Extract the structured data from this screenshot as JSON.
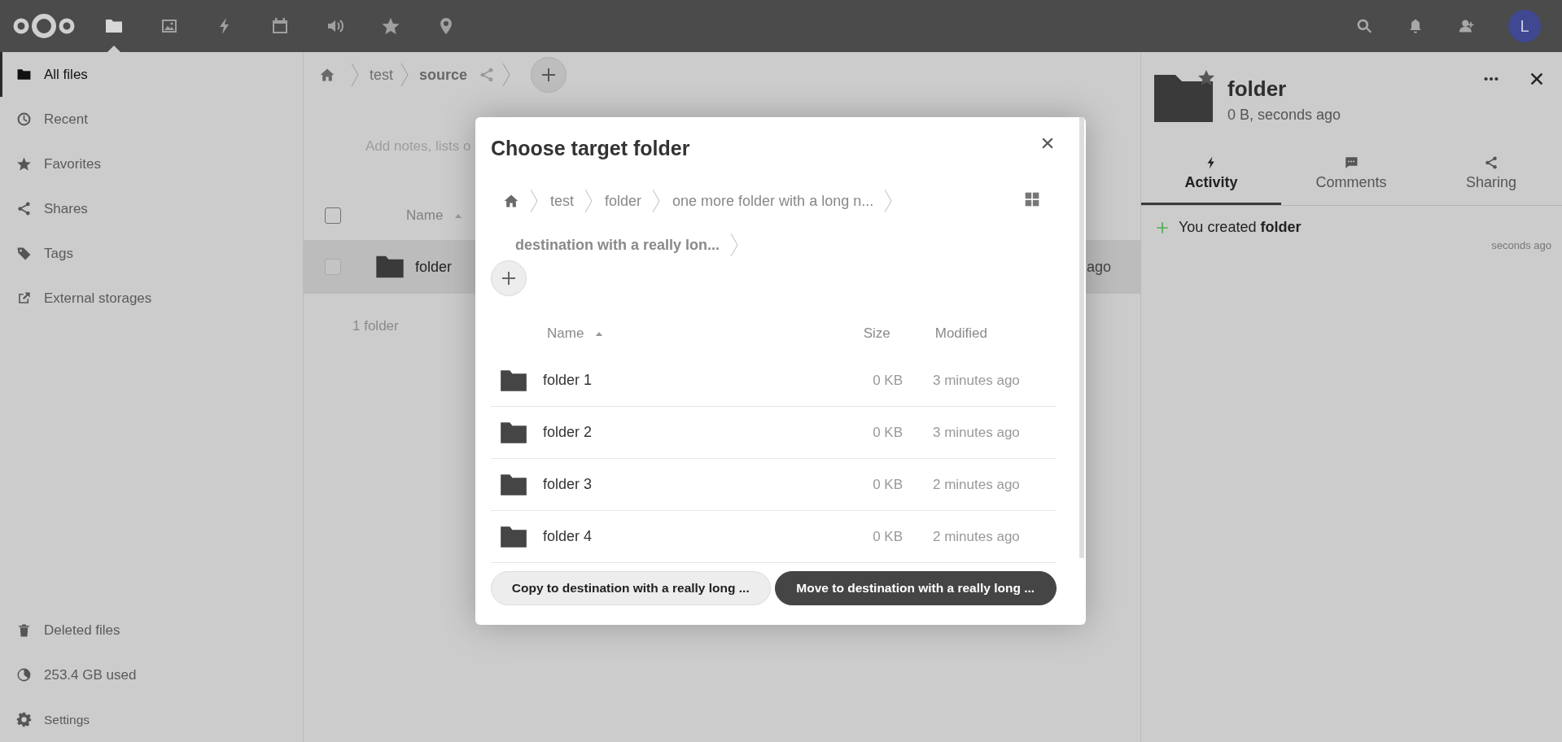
{
  "top_bar": {
    "apps": [
      {
        "kind": "files",
        "selected": true
      },
      {
        "kind": "photos",
        "selected": false
      },
      {
        "kind": "activity",
        "selected": false
      },
      {
        "kind": "calendar",
        "selected": false
      },
      {
        "kind": "audio",
        "selected": false
      },
      {
        "kind": "favorites",
        "selected": false
      },
      {
        "kind": "maps",
        "selected": false
      }
    ],
    "avatar": {
      "initial": "L"
    }
  },
  "sidebar": {
    "items": [
      {
        "label": "All files",
        "kind": "folder",
        "selected": true
      },
      {
        "label": "Recent",
        "kind": "clock",
        "selected": false
      },
      {
        "label": "Favorites",
        "kind": "star",
        "selected": false
      },
      {
        "label": "Shares",
        "kind": "share",
        "selected": false
      },
      {
        "label": "Tags",
        "kind": "tag",
        "selected": false
      },
      {
        "label": "External storages",
        "kind": "external",
        "selected": false
      }
    ],
    "footer": [
      {
        "label": "Deleted files",
        "kind": "trash"
      },
      {
        "label": "253.4 GB used",
        "kind": "quota"
      },
      {
        "label": "Settings",
        "kind": "gear"
      }
    ]
  },
  "files": {
    "breadcrumb": [
      {
        "label": "test",
        "current": false,
        "shared": false
      },
      {
        "label": "source",
        "current": true,
        "shared": true
      }
    ],
    "notes_prompt": "Add notes, lists o",
    "all_selected": false,
    "columns": {
      "name": "Name",
      "sorted_ascending": true
    },
    "rows": [
      {
        "name": "folder",
        "modified": "ago",
        "selected": true,
        "checked": false
      }
    ],
    "summary": "1 folder"
  },
  "dialog": {
    "title": "Choose target folder",
    "breadcrumb": [
      {
        "label": "test",
        "current": false
      },
      {
        "label": "folder",
        "current": false
      },
      {
        "label": "one more folder with a long n...",
        "current": false
      },
      {
        "label": "destination with a really lon...",
        "current": true
      }
    ],
    "columns": {
      "name": "Name",
      "sorted_ascending": true,
      "size": "Size",
      "modified": "Modified"
    },
    "rows": [
      {
        "name": "folder 1",
        "size": "0 KB",
        "modified": "3 minutes ago"
      },
      {
        "name": "folder 2",
        "size": "0 KB",
        "modified": "3 minutes ago"
      },
      {
        "name": "folder 3",
        "size": "0 KB",
        "modified": "2 minutes ago"
      },
      {
        "name": "folder 4",
        "size": "0 KB",
        "modified": "2 minutes ago"
      }
    ],
    "buttons": [
      {
        "label": "Copy to destination with a really long ...",
        "kind": "secondary"
      },
      {
        "label": "Move to destination with a really long ...",
        "kind": "primary"
      }
    ]
  },
  "details": {
    "title": "folder",
    "subtitle": "0 B, seconds ago",
    "tabs": [
      {
        "label": "Activity",
        "kind": "activity",
        "selected": true
      },
      {
        "label": "Comments",
        "kind": "comments",
        "selected": false
      },
      {
        "label": "Sharing",
        "kind": "sharing",
        "selected": false
      }
    ],
    "activities": [
      {
        "text": "You created **folder**",
        "time": "seconds ago"
      }
    ]
  }
}
